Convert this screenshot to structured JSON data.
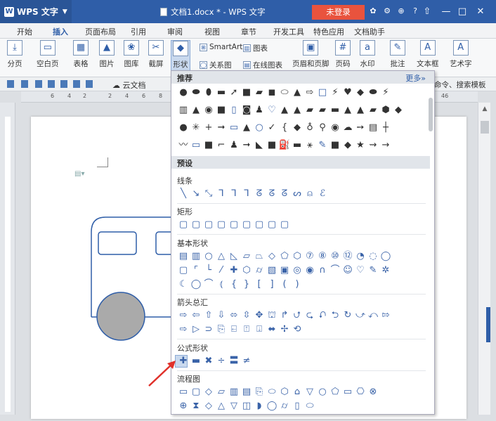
{
  "window": {
    "app_name": "WPS 文字",
    "title": "文档1.docx * - WPS 文字",
    "login_label": "未登录"
  },
  "menu": [
    "开始",
    "插入",
    "页面布局",
    "引用",
    "审阅",
    "视图",
    "章节",
    "开发工具",
    "特色应用",
    "文档助手"
  ],
  "ribbon": {
    "page_break": "分页",
    "blank_page": "空白页",
    "table": "表格",
    "picture": "图片",
    "gallery": "图库",
    "screenshot": "截屏",
    "shape": "形状",
    "smartart": "SmartArt",
    "chart": "图表",
    "relation": "关系图",
    "online_chart": "在线图表",
    "header_footer": "页眉和页脚",
    "page_number": "页码",
    "watermark": "水印",
    "comment": "批注",
    "textbox": "文本框",
    "wordart": "艺术字"
  },
  "quickbar": {
    "cloud_doc": "云文档",
    "right_text": "命令、搜索模板"
  },
  "ruler": [
    "6",
    "4",
    "2",
    "2",
    "4",
    "6",
    "8",
    "46"
  ],
  "panel": {
    "recommend": "推荐",
    "more": "更多»",
    "preset": "预设",
    "categories": {
      "lines": "线条",
      "rect": "矩形",
      "basic": "基本形状",
      "arrows": "箭头总汇",
      "formula": "公式形状",
      "flowchart": "流程图"
    }
  },
  "colors": {
    "title_bar": "#2f5ea8",
    "login": "#e9533d",
    "accent": "#2f5ea8"
  }
}
